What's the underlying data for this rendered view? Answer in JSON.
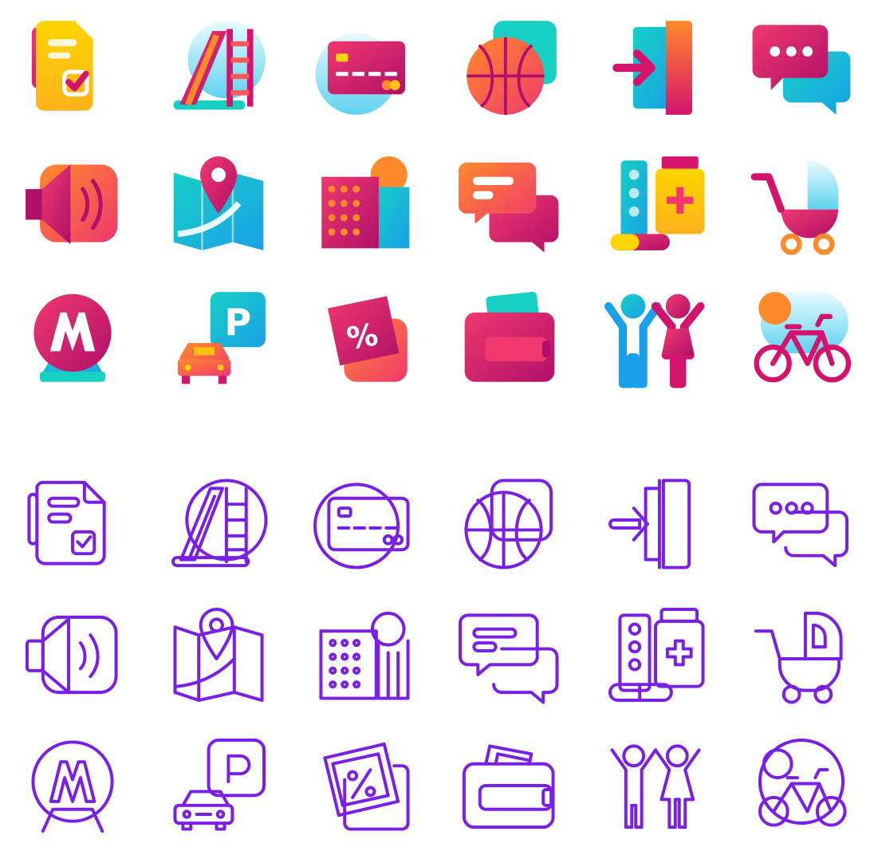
{
  "sets": {
    "gradient": {
      "style": "gradient",
      "icons": [
        "document-check-icon",
        "playground-slide-icon",
        "credit-card-icon",
        "basketball-icon",
        "door-enter-icon",
        "chat-bubbles-icon",
        "speaker-icon",
        "map-pin-icon",
        "city-building-icon",
        "message-icon",
        "pharmacy-icon",
        "baby-stroller-icon",
        "metro-icon",
        "parking-icon",
        "discount-tag-icon",
        "wallet-icon",
        "children-icon",
        "bicycle-icon"
      ]
    },
    "outline": {
      "style": "outline",
      "icons": [
        "document-check-icon",
        "playground-slide-icon",
        "credit-card-icon",
        "basketball-icon",
        "door-enter-icon",
        "chat-bubbles-icon",
        "speaker-icon",
        "map-pin-icon",
        "city-building-icon",
        "message-icon",
        "pharmacy-icon",
        "baby-stroller-icon",
        "metro-icon",
        "parking-icon",
        "discount-tag-icon",
        "wallet-icon",
        "children-icon",
        "bicycle-icon"
      ]
    }
  },
  "colors": {
    "magenta": "#d4146c",
    "pink": "#f0386e",
    "orange": "#ff8a2a",
    "yellow": "#ffd400",
    "teal": "#16d0c4",
    "blue": "#1aa0e8",
    "purple": "#7a20e6",
    "background": "#ffffff"
  }
}
